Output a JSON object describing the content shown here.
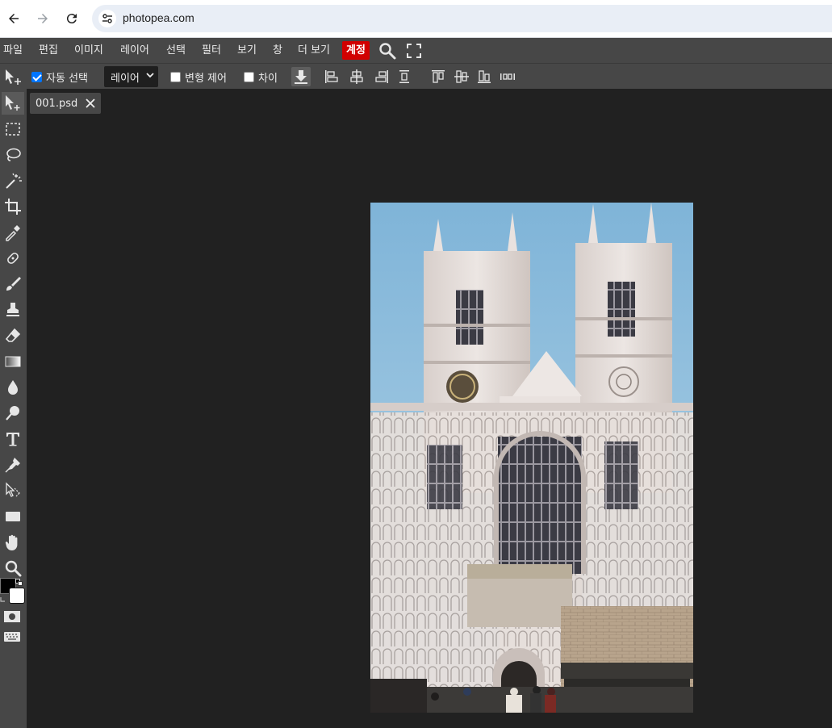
{
  "browser": {
    "url": "photopea.com"
  },
  "menu": {
    "items": [
      "파일",
      "편집",
      "이미지",
      "레이어",
      "선택",
      "필터",
      "보기",
      "창",
      "더 보기"
    ],
    "account": "계정",
    "account_color": "#d10000"
  },
  "options": {
    "auto_select_label": "자동 선택",
    "auto_select_checked": true,
    "target_select": "레이어",
    "transform_controls_label": "변형 제어",
    "transform_controls_checked": false,
    "distances_label": "차이",
    "distances_checked": false
  },
  "document": {
    "tab_name": "001.psd"
  },
  "tools": [
    "move-tool-icon",
    "marquee-tool-icon",
    "lasso-tool-icon",
    "magic-wand-icon",
    "crop-tool-icon",
    "eyedropper-icon",
    "healing-brush-icon",
    "brush-icon",
    "clone-stamp-icon",
    "eraser-icon",
    "gradient-icon",
    "blur-icon",
    "dodge-icon",
    "type-tool-icon",
    "pen-tool-icon",
    "path-select-icon",
    "shape-tool-icon",
    "hand-tool-icon",
    "zoom-tool-icon"
  ],
  "colors": {
    "foreground": "#000000",
    "background": "#ffffff",
    "ui_dark": "#474747",
    "workspace": "#212121"
  }
}
